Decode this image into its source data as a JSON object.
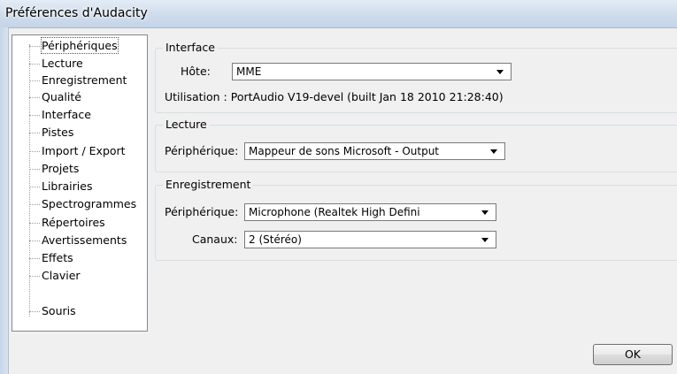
{
  "window": {
    "title": "Préférences d'Audacity"
  },
  "tree": {
    "items": [
      {
        "label": "Périphériques"
      },
      {
        "label": "Lecture"
      },
      {
        "label": "Enregistrement"
      },
      {
        "label": "Qualité"
      },
      {
        "label": "Interface"
      },
      {
        "label": "Pistes"
      },
      {
        "label": "Import / Export"
      },
      {
        "label": "Projets"
      },
      {
        "label": "Librairies"
      },
      {
        "label": "Spectrogrammes"
      },
      {
        "label": "Répertoires"
      },
      {
        "label": "Avertissements"
      },
      {
        "label": "Effets"
      },
      {
        "label": "Clavier"
      },
      {
        "label": "Souris"
      }
    ],
    "selected": "Périphériques"
  },
  "interface_group": {
    "title": "Interface",
    "host_label": "Hôte:",
    "host_value": "MME",
    "usage_text": "Utilisation : PortAudio V19-devel (built Jan 18 2010 21:28:40)"
  },
  "playback_group": {
    "title": "Lecture",
    "device_label": "Périphérique:",
    "device_value": "Mappeur de sons Microsoft - Output"
  },
  "recording_group": {
    "title": "Enregistrement",
    "device_label": "Périphérique:",
    "device_value": "Microphone (Realtek High Defini",
    "channels_label": "Canaux:",
    "channels_value": "2 (Stéréo)"
  },
  "buttons": {
    "ok_label": "OK"
  }
}
